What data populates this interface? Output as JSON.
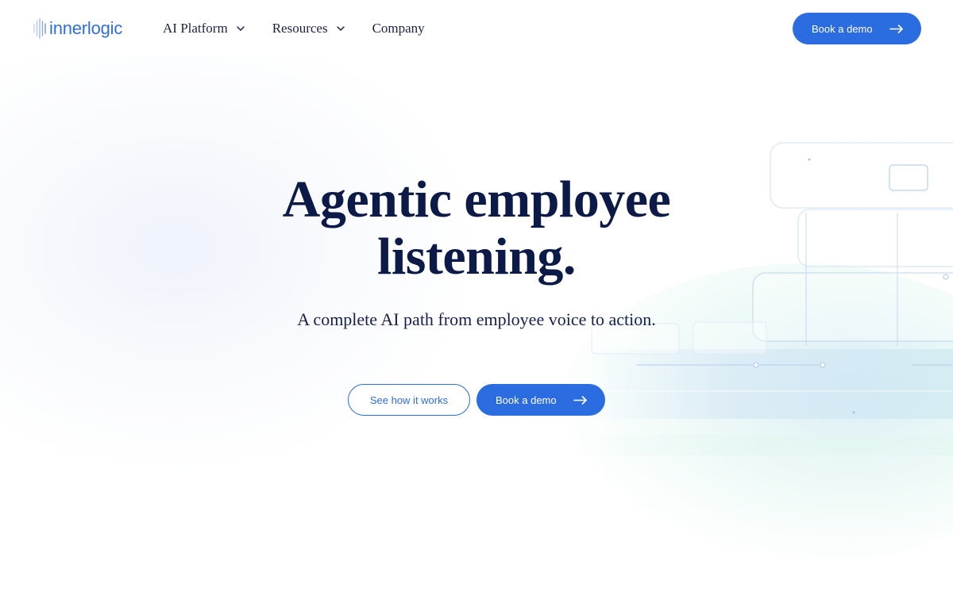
{
  "header": {
    "logo_text": "innerlogic",
    "nav": [
      {
        "label": "AI Platform",
        "has_dropdown": true
      },
      {
        "label": "Resources",
        "has_dropdown": true
      },
      {
        "label": "Company",
        "has_dropdown": false
      }
    ],
    "cta_label": "Book a demo"
  },
  "hero": {
    "title_line1": "Agentic employee",
    "title_line2": "listening.",
    "subtitle": "A complete AI path from employee voice to action.",
    "secondary_button": "See how it works",
    "primary_button": "Book a demo"
  },
  "colors": {
    "accent": "#2b6de0",
    "heading": "#0c1a47",
    "background": "#ffffff"
  },
  "icons": {
    "logo": "sound-wave-bars-icon",
    "nav_dropdown": "chevron-down-icon",
    "button_arrow": "arrow-right-icon"
  }
}
